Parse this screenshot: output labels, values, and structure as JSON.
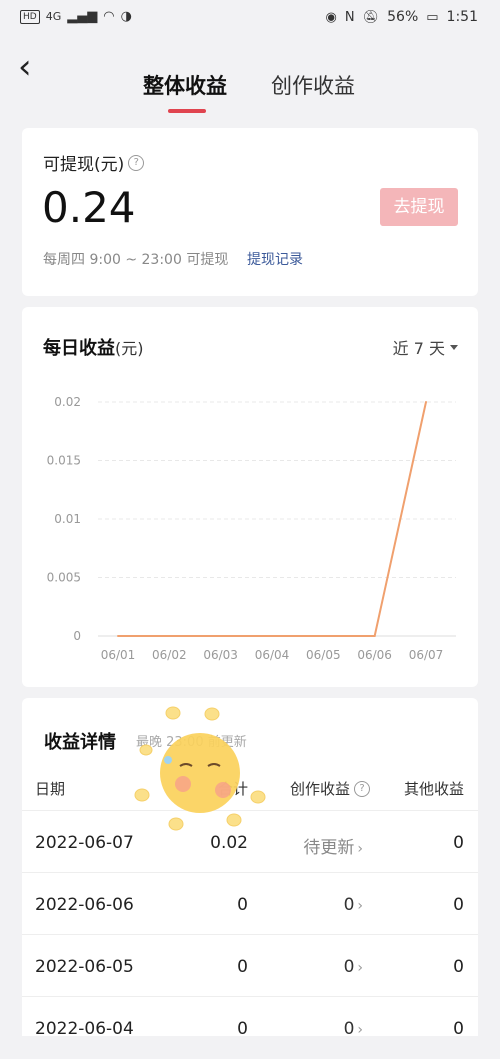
{
  "status_bar": {
    "left_badges": [
      "HD",
      "4G"
    ],
    "battery": "56%",
    "time": "1:51"
  },
  "nav": {
    "tabs": [
      {
        "label": "整体收益",
        "active": true
      },
      {
        "label": "创作收益",
        "active": false
      }
    ]
  },
  "withdraw_card": {
    "label": "可提现(元)",
    "amount": "0.24",
    "button": "去提现",
    "note": "每周四 9:00 ~ 23:00 可提现",
    "link": "提现记录"
  },
  "daily_card": {
    "title": "每日收益",
    "unit": "(元)",
    "range": "近 7 天"
  },
  "chart_data": {
    "type": "line",
    "x": [
      "06/01",
      "06/02",
      "06/03",
      "06/04",
      "06/05",
      "06/06",
      "06/07"
    ],
    "series": [
      {
        "values": [
          0,
          0,
          0,
          0,
          0,
          0,
          0.02
        ]
      }
    ],
    "yticks": [
      "0.02",
      "0.015",
      "0.01",
      "0.005",
      "0"
    ],
    "ylim": [
      0,
      0.02
    ],
    "grid": true,
    "line_color": "#f0a06e"
  },
  "detail_card": {
    "title": "收益详情",
    "subtitle": "最晚 23:00 前更新",
    "headers": [
      "日期",
      "合计",
      "创作收益",
      "其他收益"
    ],
    "rows": [
      {
        "date": "2022-06-07",
        "total": "0.02",
        "create": "待更新",
        "other": "0"
      },
      {
        "date": "2022-06-06",
        "total": "0",
        "create": "0",
        "other": "0"
      },
      {
        "date": "2022-06-05",
        "total": "0",
        "create": "0",
        "other": "0"
      },
      {
        "date": "2022-06-04",
        "total": "0",
        "create": "0",
        "other": "0"
      }
    ]
  },
  "colors": {
    "accent": "#e0444f",
    "button_disabled": "#f4b6b9",
    "link": "#3c5a9a"
  }
}
